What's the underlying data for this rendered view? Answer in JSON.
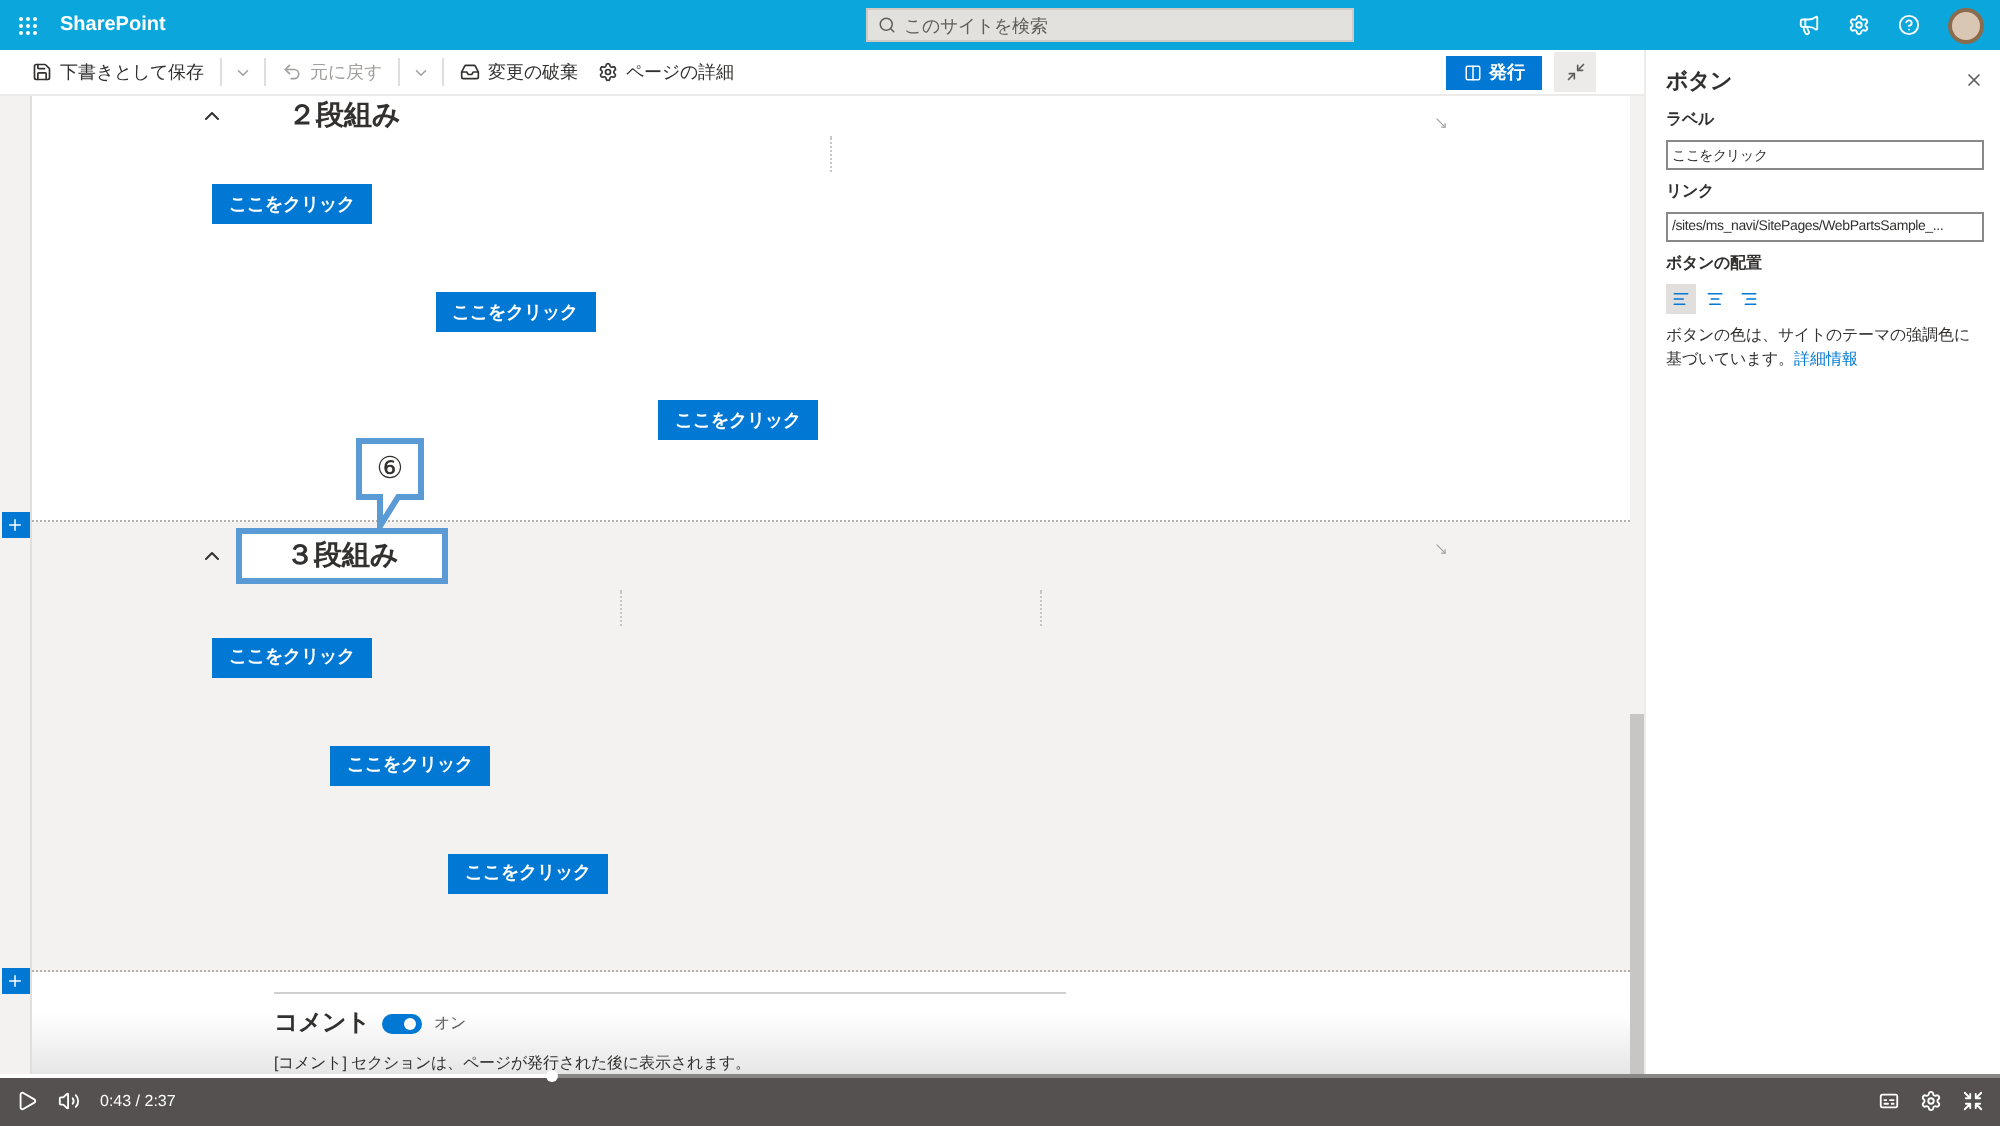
{
  "app": {
    "name": "SharePoint"
  },
  "search": {
    "placeholder": "このサイトを検索"
  },
  "command_bar": [
    {
      "kind": "save",
      "label": "下書きとして保存",
      "disabled": false,
      "menu": true
    },
    {
      "kind": "undo",
      "label": "元に戻す",
      "disabled": true,
      "menu": true
    },
    {
      "kind": "discard",
      "label": "変更の破棄",
      "disabled": false,
      "menu": false
    },
    {
      "kind": "details",
      "label": "ページの詳細",
      "disabled": false,
      "menu": false
    }
  ],
  "publish_button": "発行",
  "sections": [
    {
      "title": "２段組み",
      "kind": "two-column",
      "shaded": false,
      "buttons": [
        {
          "label": "ここをクリック",
          "kind": "left"
        },
        {
          "label": "ここをクリック",
          "kind": "center"
        },
        {
          "label": "ここをクリック",
          "kind": "right"
        }
      ]
    },
    {
      "title": "３段組み",
      "kind": "three-column",
      "shaded": true,
      "annotation": "⑥",
      "buttons": [
        {
          "label": "ここをクリック",
          "kind": "left"
        },
        {
          "label": "ここをクリック",
          "kind": "center"
        },
        {
          "label": "ここをクリック",
          "kind": "right"
        }
      ]
    }
  ],
  "comments": {
    "title": "コメント",
    "on": true,
    "state_label": "オン",
    "note": "[コメント] セクションは、ページが発行された後に表示されます。"
  },
  "panel": {
    "title": "ボタン",
    "fields": [
      {
        "label": "ラベル",
        "value": "ここをクリック"
      },
      {
        "label": "リンク",
        "value": "/sites/ms_navi/SitePages/WebPartsSample_..."
      }
    ],
    "alignment_label": "ボタンの配置",
    "alignments": [
      {
        "kind": "left",
        "selected": true
      },
      {
        "kind": "center",
        "selected": false
      },
      {
        "kind": "right",
        "selected": false
      }
    ],
    "note": "ボタンの色は、サイトのテーマの強調色に基づいています。",
    "link": "詳細情報"
  },
  "video": {
    "level": 0.276,
    "time": "0:43 / 2:37"
  }
}
